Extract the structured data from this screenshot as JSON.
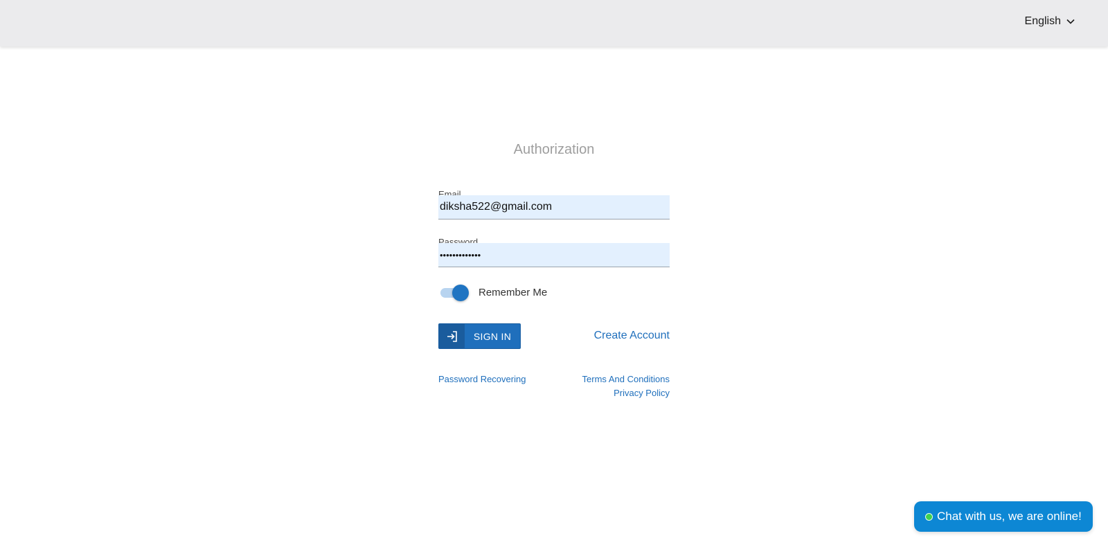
{
  "header": {
    "language": "English"
  },
  "auth": {
    "title": "Authorization",
    "email_label": "Email",
    "email_value": "diksha522@gmail.com",
    "password_label": "Password",
    "password_display": "•••••••••••••",
    "remember_label": "Remember Me",
    "remember_checked": true,
    "signin_label": "SIGN IN",
    "create_account": "Create Account",
    "password_recovering": "Password Recovering",
    "terms": "Terms And Conditions",
    "privacy": "Privacy Policy"
  },
  "chat": {
    "label": "Chat with us, we are online!",
    "status_color": "#3ed14f"
  },
  "colors": {
    "accent": "#1f6fbc",
    "header_bg": "#ebebed",
    "input_bg": "#e3f0fe",
    "chat_bg": "#0d87d4"
  }
}
